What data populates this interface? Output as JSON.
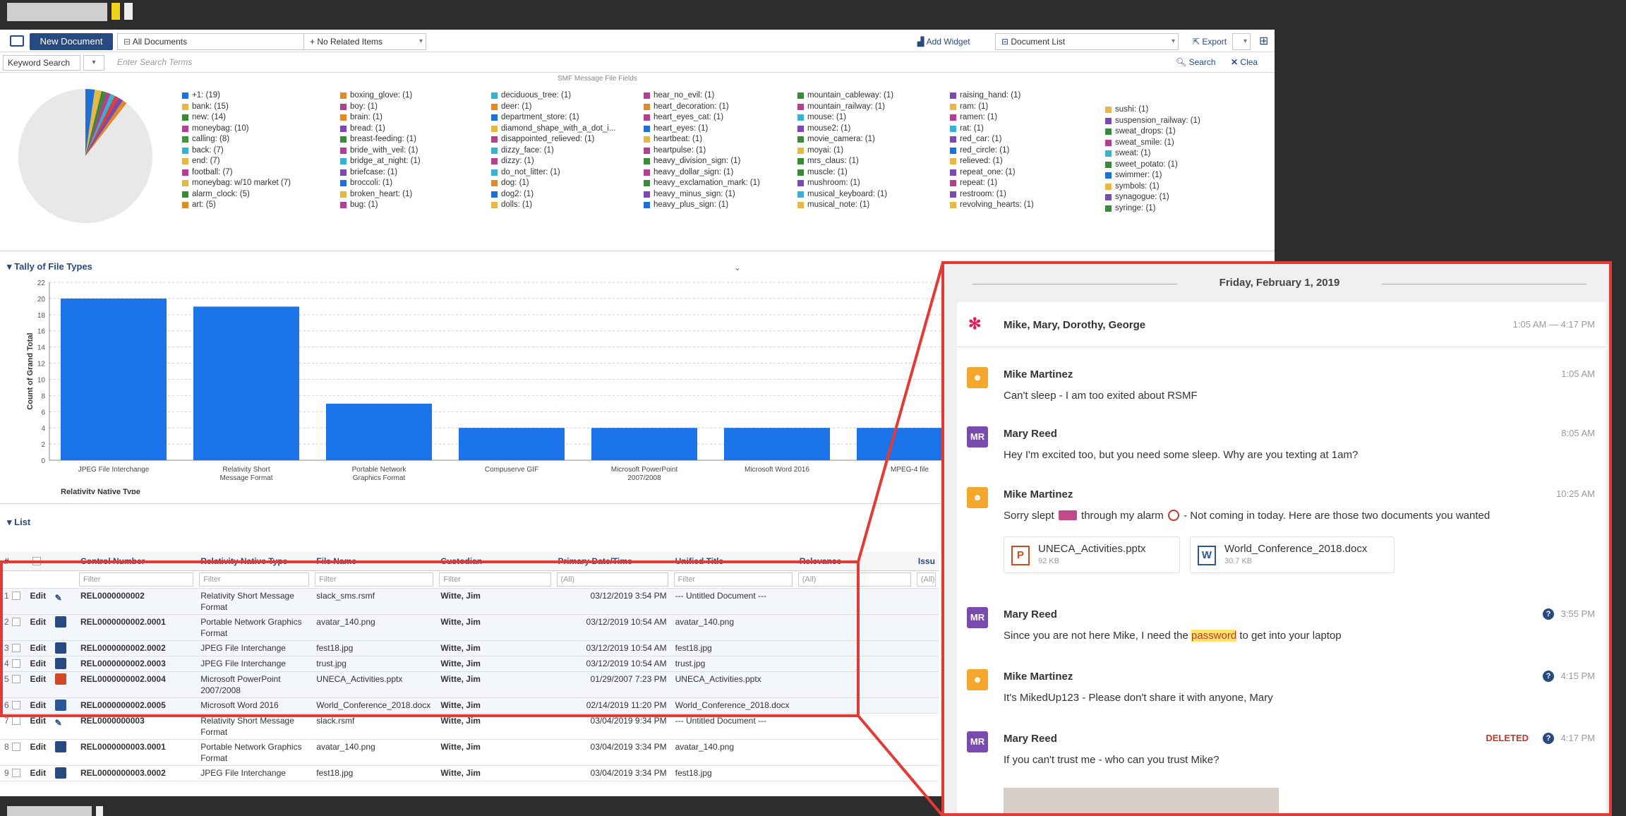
{
  "toolbar": {
    "new_document": "New Document",
    "all_documents": "All Documents",
    "related_items": "+ No Related Items",
    "add_widget": "Add Widget",
    "document_list": "Document List",
    "export": "Export"
  },
  "search": {
    "keyword_search": "Keyword Search",
    "placeholder": "Enter Search Terms",
    "search_button": "Search",
    "clear_button": "Clea"
  },
  "pie": {
    "caption": "SMF Message File Fields",
    "legend_columns": [
      [
        [
          "+1: (19)",
          "#1e6fd6"
        ],
        [
          "bank: (15)",
          "#e6b84a"
        ],
        [
          "new: (14)",
          "#3a8a3a"
        ],
        [
          "moneybag: (10)",
          "#b04090"
        ],
        [
          "calling: (8)",
          "#3a9a3a"
        ],
        [
          "back: (7)",
          "#3cb0d0"
        ],
        [
          "end: (7)",
          "#e6b84a"
        ],
        [
          "football: (7)",
          "#b04090"
        ],
        [
          "moneybag: w/10 market (7)",
          "#e6b84a"
        ],
        [
          "alarm_clock: (5)",
          "#3a8a3a"
        ],
        [
          "art: (5)",
          "#e08a2a"
        ]
      ],
      [
        [
          "boxing_glove: (1)",
          "#e08a2a"
        ],
        [
          "boy: (1)",
          "#b04090"
        ],
        [
          "brain: (1)",
          "#e08a2a"
        ],
        [
          "bread: (1)",
          "#7a4ab0"
        ],
        [
          "breast-feeding: (1)",
          "#3a8a3a"
        ],
        [
          "bride_with_veil: (1)",
          "#b04090"
        ],
        [
          "bridge_at_night: (1)",
          "#3cb0d0"
        ],
        [
          "briefcase: (1)",
          "#7a4ab0"
        ],
        [
          "broccoli: (1)",
          "#1e6fd6"
        ],
        [
          "broken_heart: (1)",
          "#e6b84a"
        ],
        [
          "bug: (1)",
          "#b04090"
        ]
      ],
      [
        [
          "deciduous_tree: (1)",
          "#3cb0d0"
        ],
        [
          "deer: (1)",
          "#e08a2a"
        ],
        [
          "department_store: (1)",
          "#1e6fd6"
        ],
        [
          "diamond_shape_with_a_dot_i...",
          "#e6b84a"
        ],
        [
          "disappointed_relieved: (1)",
          "#b04090"
        ],
        [
          "dizzy_face: (1)",
          "#3cb0d0"
        ],
        [
          "dizzy: (1)",
          "#b04090"
        ],
        [
          "do_not_litter: (1)",
          "#3cb0d0"
        ],
        [
          "dog: (1)",
          "#e08a2a"
        ],
        [
          "dog2: (1)",
          "#1e6fd6"
        ],
        [
          "dolls: (1)",
          "#e6b84a"
        ]
      ],
      [
        [
          "hear_no_evil: (1)",
          "#b04090"
        ],
        [
          "heart_decoration: (1)",
          "#e08a2a"
        ],
        [
          "heart_eyes_cat: (1)",
          "#b04090"
        ],
        [
          "heart_eyes: (1)",
          "#1e6fd6"
        ],
        [
          "heartbeat: (1)",
          "#e6b84a"
        ],
        [
          "heartpulse: (1)",
          "#b04090"
        ],
        [
          "heavy_division_sign: (1)",
          "#3a8a3a"
        ],
        [
          "heavy_dollar_sign: (1)",
          "#b04090"
        ],
        [
          "heavy_exclamation_mark: (1)",
          "#3a8a3a"
        ],
        [
          "heavy_minus_sign: (1)",
          "#7a4ab0"
        ],
        [
          "heavy_plus_sign: (1)",
          "#1e6fd6"
        ]
      ],
      [
        [
          "mountain_cableway: (1)",
          "#3a8a3a"
        ],
        [
          "mountain_railway: (1)",
          "#b04090"
        ],
        [
          "mouse: (1)",
          "#3cb0d0"
        ],
        [
          "mouse2: (1)",
          "#7a4ab0"
        ],
        [
          "movie_camera: (1)",
          "#3a8a3a"
        ],
        [
          "moyai: (1)",
          "#e6b84a"
        ],
        [
          "mrs_claus: (1)",
          "#3a8a3a"
        ],
        [
          "muscle: (1)",
          "#3a8a3a"
        ],
        [
          "mushroom: (1)",
          "#7a4ab0"
        ],
        [
          "musical_keyboard: (1)",
          "#3cb0d0"
        ],
        [
          "musical_note: (1)",
          "#e6b84a"
        ]
      ],
      [
        [
          "raising_hand: (1)",
          "#7a4ab0"
        ],
        [
          "ram: (1)",
          "#e6b84a"
        ],
        [
          "ramen: (1)",
          "#b04090"
        ],
        [
          "rat: (1)",
          "#3cb0d0"
        ],
        [
          "red_car: (1)",
          "#7a4ab0"
        ],
        [
          "red_circle: (1)",
          "#1e6fd6"
        ],
        [
          "relieved: (1)",
          "#e6b84a"
        ],
        [
          "repeat_one: (1)",
          "#7a4ab0"
        ],
        [
          "repeat: (1)",
          "#b04090"
        ],
        [
          "restroom: (1)",
          "#7a4ab0"
        ],
        [
          "revolving_hearts: (1)",
          "#e6b84a"
        ]
      ],
      [
        [
          "sushi: (1)",
          "#e6b84a"
        ],
        [
          "suspension_railway: (1)",
          "#7a4ab0"
        ],
        [
          "sweat_drops: (1)",
          "#3a8a3a"
        ],
        [
          "sweat_smile: (1)",
          "#b04090"
        ],
        [
          "sweat: (1)",
          "#3cb0d0"
        ],
        [
          "sweet_potato: (1)",
          "#3a8a3a"
        ],
        [
          "swimmer: (1)",
          "#1e6fd6"
        ],
        [
          "symbols: (1)",
          "#e6b84a"
        ],
        [
          "synagogue: (1)",
          "#7a4ab0"
        ],
        [
          "syringe: (1)",
          "#3a8a3a"
        ]
      ]
    ]
  },
  "chart_section": {
    "title": "Tally of File Types"
  },
  "chart_data": {
    "type": "bar",
    "title": "Tally of File Types",
    "xlabel": "Relativity Native Type",
    "ylabel": "Count of Grand Total",
    "ylim": [
      0,
      22
    ],
    "yticks": [
      0,
      2,
      4,
      6,
      8,
      10,
      12,
      14,
      16,
      18,
      20,
      22
    ],
    "categories": [
      "JPEG File Interchange",
      "Relativity Short Message Format",
      "Portable Network Graphics Format",
      "Compuserve GIF",
      "Microsoft PowerPoint 2007/2008",
      "Microsoft Word 2016",
      "MPEG-4 file"
    ],
    "values": [
      20,
      19,
      7,
      4,
      4,
      4,
      4
    ],
    "bar_color": "#1a73e8",
    "grid": true
  },
  "list_section": {
    "title": "List",
    "headers": [
      "#",
      "",
      "",
      "Control Number",
      "Relativity Native Type",
      "File Name",
      "Custodian",
      "Primary Date/Time",
      "Unified Title",
      "Relevance",
      "Issu"
    ],
    "filters": [
      "",
      "",
      "",
      "Filter",
      "Filter",
      "Filter",
      "Filter",
      "(All)",
      "Filter",
      "(All)",
      "(All)"
    ],
    "rows": [
      {
        "n": "1",
        "edit": "Edit",
        "icon": "pencil",
        "ctrl": "REL0000000002",
        "type": "Relativity Short Message Format",
        "file": "slack_sms.rsmf",
        "cust": "Witte, Jim",
        "date": "03/12/2019 3:54 PM",
        "title": "--- Untitled Document ---"
      },
      {
        "n": "2",
        "edit": "Edit",
        "icon": "image",
        "ctrl": "REL0000000002.0001",
        "type": "Portable Network Graphics Format",
        "file": "avatar_140.png",
        "cust": "Witte, Jim",
        "date": "03/12/2019 10:54 AM",
        "title": "avatar_140.png"
      },
      {
        "n": "3",
        "edit": "Edit",
        "icon": "image",
        "ctrl": "REL0000000002.0002",
        "type": "JPEG File Interchange",
        "file": "fest18.jpg",
        "cust": "Witte, Jim",
        "date": "03/12/2019 10:54 AM",
        "title": "fest18.jpg"
      },
      {
        "n": "4",
        "edit": "Edit",
        "icon": "image",
        "ctrl": "REL0000000002.0003",
        "type": "JPEG File Interchange",
        "file": "trust.jpg",
        "cust": "Witte, Jim",
        "date": "03/12/2019 10:54 AM",
        "title": "trust.jpg"
      },
      {
        "n": "5",
        "edit": "Edit",
        "icon": "ppt",
        "ctrl": "REL0000000002.0004",
        "type": "Microsoft PowerPoint 2007/2008",
        "file": "UNECA_Activities.pptx",
        "cust": "Witte, Jim",
        "date": "01/29/2007 7:23 PM",
        "title": "UNECA_Activities.pptx"
      },
      {
        "n": "6",
        "edit": "Edit",
        "icon": "word",
        "ctrl": "REL0000000002.0005",
        "type": "Microsoft Word 2016",
        "file": "World_Conference_2018.docx",
        "cust": "Witte, Jim",
        "date": "02/14/2019 11:20 PM",
        "title": "World_Conference_2018.docx"
      },
      {
        "n": "7",
        "edit": "Edit",
        "icon": "pencil",
        "ctrl": "REL0000000003",
        "type": "Relativity Short Message Format",
        "file": "slack.rsmf",
        "cust": "Witte, Jim",
        "date": "03/04/2019 9:34 PM",
        "title": "--- Untitled Document ---"
      },
      {
        "n": "8",
        "edit": "Edit",
        "icon": "image",
        "ctrl": "REL0000000003.0001",
        "type": "Portable Network Graphics Format",
        "file": "avatar_140.png",
        "cust": "Witte, Jim",
        "date": "03/04/2019 3:34 PM",
        "title": "avatar_140.png"
      },
      {
        "n": "9",
        "edit": "Edit",
        "icon": "image",
        "ctrl": "REL0000000003.0002",
        "type": "JPEG File Interchange",
        "file": "fest18.jpg",
        "cust": "Witte, Jim",
        "date": "03/04/2019 3:34 PM",
        "title": "fest18.jpg"
      }
    ]
  },
  "chat": {
    "date": "Friday, February 1, 2019",
    "participants": "Mike, Mary, Dorothy, George",
    "range": "1:05 AM — 4:17 PM",
    "messages": [
      {
        "initials": "",
        "who": "Mike Martinez",
        "time": "1:05 AM",
        "text": "Can't sleep - I am too exited about RSMF"
      },
      {
        "initials": "MR",
        "who": "Mary Reed",
        "time": "8:05 AM",
        "text": "Hey I'm excited too, but you need some sleep. Why are you texting at 1am?"
      },
      {
        "initials": "",
        "who": "Mike Martinez",
        "time": "10:25 AM",
        "text_a": "Sorry slept",
        "text_b": "through my alarm",
        "text_c": "- Not coming in today. Here are those two documents you wanted"
      },
      {
        "initials": "MR",
        "who": "Mary Reed",
        "time": "3:55 PM",
        "text_a": "Since you are not here Mike, I need the",
        "text_hl": "password",
        "text_c": "to get into your laptop"
      },
      {
        "initials": "",
        "who": "Mike Martinez",
        "time": "4:15 PM",
        "text": "It's MikedUp123 - Please don't share it with anyone, Mary"
      },
      {
        "initials": "MR",
        "who": "Mary Reed",
        "time": "4:17 PM",
        "deleted": "DELETED",
        "text": "If you can't trust me - who can you trust Mike?"
      }
    ],
    "attachments": [
      {
        "letter": "P",
        "name": "UNECA_Activities.pptx",
        "size": "92 KB",
        "color": "#d24726"
      },
      {
        "letter": "W",
        "name": "World_Conference_2018.docx",
        "size": "30.7 KB",
        "color": "#2b579a"
      }
    ]
  }
}
